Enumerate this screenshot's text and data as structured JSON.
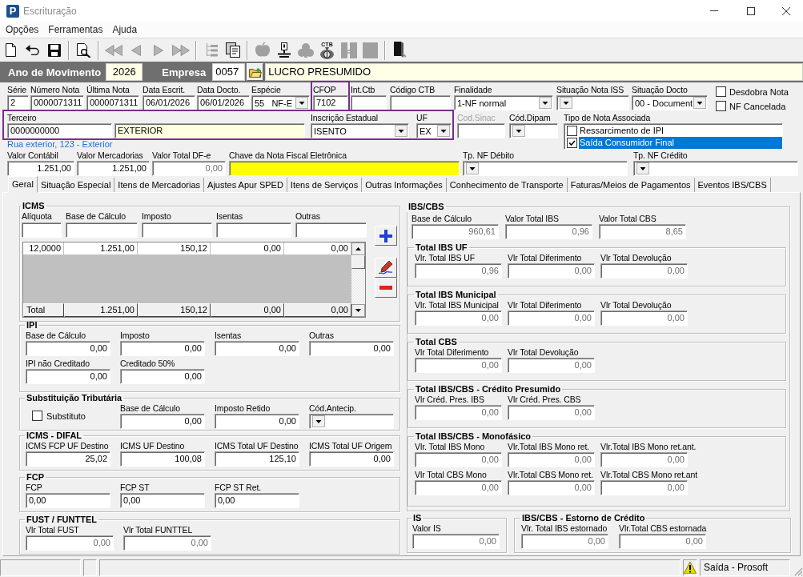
{
  "window": {
    "logo": "P",
    "title": "Escrituração"
  },
  "menu": [
    "Opções",
    "Ferramentas",
    "Ajuda"
  ],
  "toolbar": [
    [
      {
        "kind": "new",
        "disabled": false
      },
      {
        "kind": "undo",
        "disabled": false
      },
      {
        "kind": "save",
        "disabled": false
      }
    ],
    [
      {
        "kind": "preview",
        "disabled": false
      }
    ],
    [
      {
        "kind": "first",
        "disabled": true
      },
      {
        "kind": "previous",
        "disabled": true
      },
      {
        "kind": "next",
        "disabled": true
      },
      {
        "kind": "last",
        "disabled": true
      }
    ],
    [
      {
        "kind": "tree",
        "disabled": true
      },
      {
        "kind": "report",
        "disabled": false
      }
    ],
    [
      {
        "kind": "shape",
        "disabled": true
      },
      {
        "kind": "stamp",
        "disabled": false
      },
      {
        "kind": "cloud",
        "disabled": true
      },
      {
        "kind": "bag",
        "disabled": false,
        "caption": "CTB"
      },
      {
        "kind": "split",
        "disabled": true
      },
      {
        "kind": "block",
        "disabled": true
      }
    ],
    [
      {
        "kind": "exit",
        "disabled": false
      }
    ]
  ],
  "company_bar": {
    "year_label": "Ano de Movimento",
    "year": "2026",
    "company_label": "Empresa",
    "company_code": "0057",
    "company_name": "LUCRO PRESUMIDO"
  },
  "header": {
    "row_1": [
      {
        "label": "Série",
        "value": "2",
        "kind": "text",
        "highlighted": false
      },
      {
        "label": "Número Nota",
        "value": "0000071311",
        "kind": "text",
        "highlighted": false
      },
      {
        "label": "Última Nota",
        "value": "0000071311",
        "kind": "text",
        "highlighted": false
      },
      {
        "label": "Data Escrit.",
        "value": "06/01/2026",
        "kind": "text",
        "highlighted": false
      },
      {
        "label": "Data Docto.",
        "value": "06/01/2026",
        "kind": "text",
        "highlighted": false
      },
      {
        "label": "Espécie",
        "value": "55   NF-E",
        "kind": "combo",
        "highlighted": false
      },
      {
        "label": "CFOP",
        "value": "7102",
        "kind": "text",
        "highlighted": true
      },
      {
        "label": "Int.Ctb",
        "kind": "text",
        "highlighted": false
      },
      {
        "label": "Código CTB",
        "kind": "text",
        "highlighted": false
      },
      {
        "label": "Finalidade",
        "value": "1-NF normal",
        "kind": "combo",
        "highlighted": false
      },
      {
        "label": "Situação Nota ISS",
        "kind": "combo",
        "highlighted": false
      },
      {
        "label": "Situação Docto",
        "value": "00 - Document",
        "kind": "combo",
        "highlighted": false
      }
    ],
    "flags": [
      {
        "label": "Desdobra Nota",
        "checked": false
      },
      {
        "label": "NF Cancelada",
        "checked": false
      }
    ],
    "party": {
      "highlighted": true,
      "fields": [
        {
          "label": "Terceiro",
          "value": "0000000000",
          "kind": "text"
        },
        {
          "value": "EXTERIOR",
          "kind": "display"
        },
        {
          "label": "Inscrição Estadual",
          "value": "ISENTO",
          "kind": "combo"
        },
        {
          "label": "UF",
          "value": "EX",
          "kind": "combo"
        }
      ]
    },
    "row_2": [
      {
        "label": "Cod.Sinac",
        "kind": "text",
        "disabled": true
      },
      {
        "label": "Cód.Dipam",
        "kind": "combo",
        "disabled": false
      }
    ],
    "note_types": {
      "label": "Tipo de Nota Associada",
      "items": [
        {
          "label": "Ressarcimento de IPI",
          "checked": false,
          "selected": false
        },
        {
          "label": "Saída Consumidor Final",
          "checked": true,
          "selected": true
        }
      ]
    },
    "address": "Rua exterior, 123 - Exterior",
    "row_3": [
      {
        "label": "Valor Contábil",
        "value": "1.251,00",
        "kind": "number",
        "readonly": false,
        "required": false
      },
      {
        "label": "Valor Mercadorias",
        "value": "1.251,00",
        "kind": "number",
        "readonly": false,
        "required": false
      },
      {
        "label": "Valor Total DF-e",
        "value": "0,00",
        "kind": "number",
        "readonly": true,
        "required": false
      },
      {
        "label": "Chave da Nota Fiscal Eletrônica",
        "kind": "text",
        "readonly": false,
        "required": true
      },
      {
        "label": "Tp. NF Débito",
        "kind": "combo",
        "required": false
      },
      {
        "label": "Tp. NF Crédito",
        "kind": "combo",
        "required": false
      }
    ]
  },
  "tabs": [
    {
      "label": "Geral",
      "selected": true
    },
    {
      "label": "Situação Especial",
      "selected": false
    },
    {
      "label": "Itens de Mercadorias",
      "selected": false
    },
    {
      "label": "Ajustes Apur SPED",
      "selected": false
    },
    {
      "label": "Itens de Serviços",
      "selected": false
    },
    {
      "label": "Outras Informações",
      "selected": false
    },
    {
      "label": "Conhecimento de Transporte",
      "selected": false
    },
    {
      "label": "Faturas/Meios de Pagamentos",
      "selected": false
    },
    {
      "label": "Eventos IBS/CBS",
      "selected": false
    }
  ],
  "icms": {
    "title": "ICMS",
    "columns": [
      "Alíquota",
      "Base de Cálculo",
      "Imposto",
      "Isentas",
      "Outras"
    ],
    "rows": [
      [
        "12,0000",
        "1.251,00",
        "150,12",
        "0,00",
        "0,00"
      ]
    ],
    "total": [
      "Total",
      "1.251,00",
      "150,12",
      "0,00",
      "0,00"
    ]
  },
  "left_groups": [
    {
      "title": "IPI",
      "rows": [
        [
          {
            "label": "Base de Cálculo",
            "value": "0,00",
            "kind": "number",
            "readonly": false
          },
          {
            "label": "Imposto",
            "value": "0,00",
            "kind": "number",
            "readonly": false
          },
          {
            "label": "Isentas",
            "value": "0,00",
            "kind": "number",
            "readonly": false
          },
          {
            "label": "Outras",
            "value": "0,00",
            "kind": "number",
            "readonly": false
          }
        ],
        [
          {
            "label": "IPI não Creditado",
            "value": "0,00",
            "kind": "number",
            "readonly": false
          },
          {
            "label": "Creditado 50%",
            "value": "0,00",
            "kind": "number",
            "readonly": false
          }
        ]
      ]
    },
    {
      "title": "Substituição Tributária",
      "rows": [
        [
          {
            "label": "Substituto",
            "kind": "checkbox",
            "checked": false
          },
          {
            "label": "Base de Cálculo",
            "value": "0,00",
            "kind": "number",
            "readonly": false
          },
          {
            "label": "Imposto Retido",
            "value": "0,00",
            "kind": "number",
            "readonly": false
          },
          {
            "label": "Cód.Antecip.",
            "kind": "combo"
          }
        ]
      ]
    },
    {
      "title": "ICMS - DIFAL",
      "rows": [
        [
          {
            "label": "ICMS FCP UF Destino",
            "value": "25,02",
            "kind": "number",
            "readonly": false
          },
          {
            "label": "ICMS UF Destino",
            "value": "100,08",
            "kind": "number",
            "readonly": false
          },
          {
            "label": "ICMS Total UF Destino",
            "value": "125,10",
            "kind": "number",
            "readonly": false
          },
          {
            "label": "ICMS Total UF Origem",
            "value": "0,00",
            "kind": "number",
            "readonly": false
          }
        ]
      ]
    },
    {
      "title": "FCP",
      "rows": [
        [
          {
            "label": "FCP",
            "value": "0,00",
            "kind": "text",
            "readonly": false
          },
          {
            "label": "FCP ST",
            "value": "0,00",
            "kind": "text",
            "readonly": false
          },
          {
            "label": "FCP ST Ret.",
            "value": "0,00",
            "kind": "text",
            "readonly": false
          }
        ]
      ]
    },
    {
      "title": "FUST / FUNTTEL",
      "rows": [
        [
          {
            "label": "Vlr Total FUST",
            "value": "0,00",
            "kind": "number",
            "readonly": true
          },
          {
            "label": "Vlr Total FUNTTEL",
            "value": "0,00",
            "kind": "number",
            "readonly": true
          }
        ]
      ]
    }
  ],
  "ibs_cbs": {
    "title": "IBS/CBS",
    "fields": [
      {
        "label": "Base de Cálculo",
        "value": "960,61",
        "kind": "number",
        "readonly": true
      },
      {
        "label": "Valor Total IBS",
        "value": "0,96",
        "kind": "number",
        "readonly": true
      },
      {
        "label": "Valor Total CBS",
        "value": "8,65",
        "kind": "number",
        "readonly": true
      }
    ],
    "groups": [
      {
        "title": "Total IBS UF",
        "rows": [
          [
            {
              "label": "Vlr. Total IBS UF",
              "value": "0,96",
              "kind": "number",
              "readonly": true
            },
            {
              "label": "Vlr Total Diferimento",
              "value": "0,00",
              "kind": "number",
              "readonly": true
            },
            {
              "label": "Vlr Total Devolução",
              "value": "0,00",
              "kind": "number",
              "readonly": true
            }
          ]
        ]
      },
      {
        "title": "Total IBS Municipal",
        "rows": [
          [
            {
              "label": "Vlr. Total IBS Municipal",
              "value": "0,00",
              "kind": "number",
              "readonly": true
            },
            {
              "label": "Vlr Total Diferimento",
              "value": "0,00",
              "kind": "number",
              "readonly": true
            },
            {
              "label": "Vlr Total Devolução",
              "value": "0,00",
              "kind": "number",
              "readonly": true
            }
          ]
        ]
      },
      {
        "title": "Total CBS",
        "rows": [
          [
            {
              "label": "Vlr Total Diferimento",
              "value": "0,00",
              "kind": "number",
              "readonly": true
            },
            {
              "label": "Vlr Total Devolução",
              "value": "0,00",
              "kind": "number",
              "readonly": true
            }
          ]
        ]
      },
      {
        "title": "Total IBS/CBS - Crédito Presumido",
        "rows": [
          [
            {
              "label": "Vlr Créd. Pres. IBS",
              "value": "0,00",
              "kind": "number",
              "readonly": true
            },
            {
              "label": "Vlr Créd. Pres. CBS",
              "value": "0,00",
              "kind": "number",
              "readonly": true
            }
          ]
        ]
      },
      {
        "title": "Total IBS/CBS - Monofásico",
        "rows": [
          [
            {
              "label": "Vlr. Total IBS Mono",
              "value": "0,00",
              "kind": "number",
              "readonly": true
            },
            {
              "label": "Vlr.Total IBS Mono ret.",
              "value": "0,00",
              "kind": "number",
              "readonly": true
            },
            {
              "label": "Vlr.Total IBS Mono ret.ant.",
              "value": "0,00",
              "kind": "number",
              "readonly": true
            }
          ],
          [
            {
              "label": "Vlr Total CBS Mono",
              "value": "0,00",
              "kind": "number",
              "readonly": true
            },
            {
              "label": "Vlr.Total CBS Mono ret.",
              "value": "0,00",
              "kind": "number",
              "readonly": true
            },
            {
              "label": "Vlr.Total CBS Mono ret.ant",
              "value": "0,00",
              "kind": "number",
              "readonly": true
            }
          ]
        ]
      }
    ]
  },
  "bottom_groups": [
    {
      "title": "IS",
      "rows": [
        [
          {
            "label": "Valor IS",
            "value": "0,00",
            "kind": "number",
            "readonly": true
          }
        ]
      ]
    },
    {
      "title": "IBS/CBS - Estorno de Crédito",
      "rows": [
        [
          {
            "label": "Vlr. Total IBS estornado",
            "value": "0,00",
            "kind": "number",
            "readonly": true
          },
          {
            "label": "Vlr.Total CBS estornada",
            "value": "0,00",
            "kind": "number",
            "readonly": true
          }
        ]
      ]
    }
  ],
  "status_bar": {
    "text": "Saída - Prosoft"
  }
}
